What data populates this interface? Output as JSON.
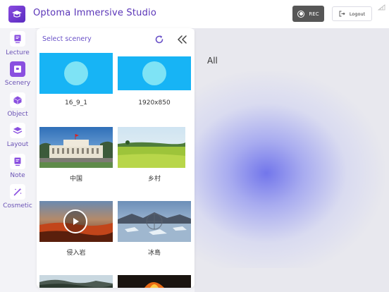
{
  "header": {
    "app_title": "Optoma Immersive Studio",
    "rec_label": "REC",
    "logout_label": "Logout"
  },
  "sidebar": {
    "items": [
      {
        "label": "Lecture",
        "icon": "lecture-icon",
        "active": false
      },
      {
        "label": "Scenery",
        "icon": "scenery-icon",
        "active": true
      },
      {
        "label": "Object",
        "icon": "object-icon",
        "active": false
      },
      {
        "label": "Layout",
        "icon": "layout-icon",
        "active": false
      },
      {
        "label": "Note",
        "icon": "note-icon",
        "active": false
      },
      {
        "label": "Cosmetic",
        "icon": "cosmetic-icon",
        "active": false
      }
    ]
  },
  "panel": {
    "title": "Select scenery",
    "scenes": [
      {
        "label": "16_9_1"
      },
      {
        "label": "1920x850"
      },
      {
        "label": "中国"
      },
      {
        "label": "乡村"
      },
      {
        "label": "侵入岩"
      },
      {
        "label": "冰島"
      }
    ]
  },
  "workspace": {
    "filter_label": "All"
  },
  "colors": {
    "brand": "#5a35b8",
    "accent": "#8a4fe0",
    "thumb_blue": "#17b4f5"
  }
}
